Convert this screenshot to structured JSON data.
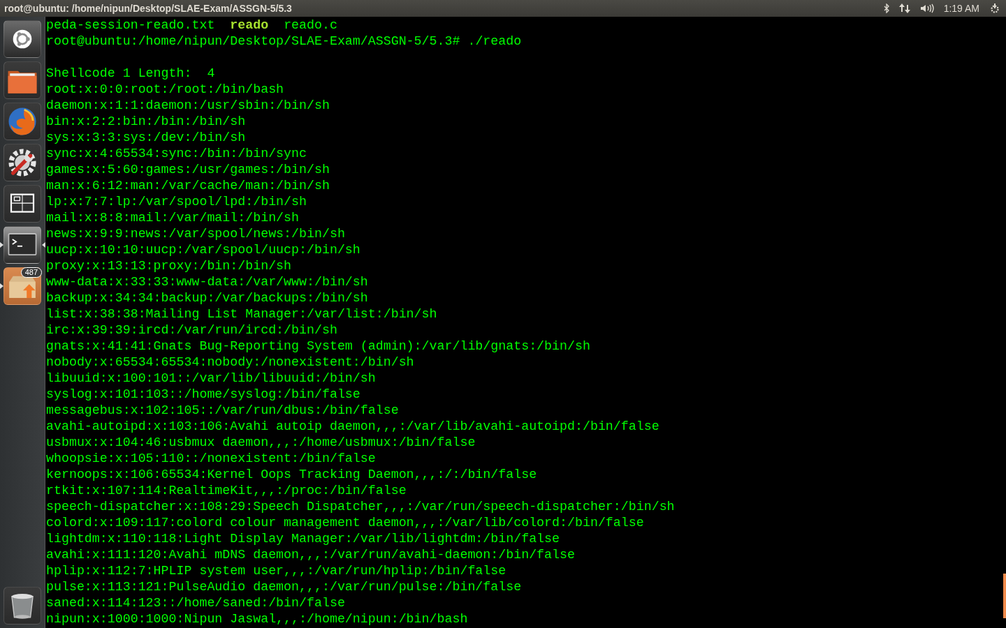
{
  "top_bar": {
    "title": "root@ubuntu: /home/nipun/Desktop/SLAE-Exam/ASSGN-5/5.3",
    "clock": "1:19 AM"
  },
  "launcher": {
    "items": [
      {
        "kind": "dash",
        "running": false,
        "focused": false
      },
      {
        "kind": "files",
        "running": false,
        "focused": false
      },
      {
        "kind": "browser",
        "running": false,
        "focused": false
      },
      {
        "kind": "settings",
        "running": false,
        "focused": false
      },
      {
        "kind": "workspaces",
        "running": false,
        "focused": false
      },
      {
        "kind": "terminal",
        "running": true,
        "focused": true
      },
      {
        "kind": "updates",
        "running": true,
        "focused": false,
        "badge": "487"
      }
    ],
    "trash": {
      "kind": "trash"
    }
  },
  "terminal": {
    "listing": [
      {
        "name": "peda-session-reado.txt",
        "kind": "file"
      },
      {
        "name": "reado",
        "kind": "executable"
      },
      {
        "name": "reado.c",
        "kind": "file"
      }
    ],
    "prompt": "root@ubuntu:/home/nipun/Desktop/SLAE-Exam/ASSGN-5/5.3#",
    "command": "./reado",
    "output": [
      "Shellcode 1 Length:  4",
      "root:x:0:0:root:/root:/bin/bash",
      "daemon:x:1:1:daemon:/usr/sbin:/bin/sh",
      "bin:x:2:2:bin:/bin:/bin/sh",
      "sys:x:3:3:sys:/dev:/bin/sh",
      "sync:x:4:65534:sync:/bin:/bin/sync",
      "games:x:5:60:games:/usr/games:/bin/sh",
      "man:x:6:12:man:/var/cache/man:/bin/sh",
      "lp:x:7:7:lp:/var/spool/lpd:/bin/sh",
      "mail:x:8:8:mail:/var/mail:/bin/sh",
      "news:x:9:9:news:/var/spool/news:/bin/sh",
      "uucp:x:10:10:uucp:/var/spool/uucp:/bin/sh",
      "proxy:x:13:13:proxy:/bin:/bin/sh",
      "www-data:x:33:33:www-data:/var/www:/bin/sh",
      "backup:x:34:34:backup:/var/backups:/bin/sh",
      "list:x:38:38:Mailing List Manager:/var/list:/bin/sh",
      "irc:x:39:39:ircd:/var/run/ircd:/bin/sh",
      "gnats:x:41:41:Gnats Bug-Reporting System (admin):/var/lib/gnats:/bin/sh",
      "nobody:x:65534:65534:nobody:/nonexistent:/bin/sh",
      "libuuid:x:100:101::/var/lib/libuuid:/bin/sh",
      "syslog:x:101:103::/home/syslog:/bin/false",
      "messagebus:x:102:105::/var/run/dbus:/bin/false",
      "avahi-autoipd:x:103:106:Avahi autoip daemon,,,:/var/lib/avahi-autoipd:/bin/false",
      "usbmux:x:104:46:usbmux daemon,,,:/home/usbmux:/bin/false",
      "whoopsie:x:105:110::/nonexistent:/bin/false",
      "kernoops:x:106:65534:Kernel Oops Tracking Daemon,,,:/:/bin/false",
      "rtkit:x:107:114:RealtimeKit,,,:/proc:/bin/false",
      "speech-dispatcher:x:108:29:Speech Dispatcher,,,:/var/run/speech-dispatcher:/bin/sh",
      "colord:x:109:117:colord colour management daemon,,,:/var/lib/colord:/bin/false",
      "lightdm:x:110:118:Light Display Manager:/var/lib/lightdm:/bin/false",
      "avahi:x:111:120:Avahi mDNS daemon,,,:/var/run/avahi-daemon:/bin/false",
      "hplip:x:112:7:HPLIP system user,,,:/var/run/hplip:/bin/false",
      "pulse:x:113:121:PulseAudio daemon,,,:/var/run/pulse:/bin/false",
      "saned:x:114:123::/home/saned:/bin/false",
      "nipun:x:1000:1000:Nipun Jaswal,,,:/home/nipun:/bin/bash"
    ]
  }
}
